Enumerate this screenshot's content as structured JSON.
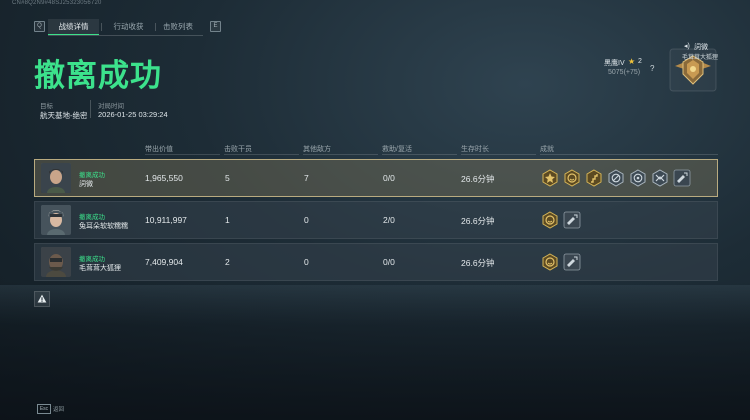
{
  "watermark": "CN#8Q2N9#48SJ25323056720",
  "tabs": {
    "left_key": "Q",
    "right_key": "E",
    "items": [
      {
        "label": "战绩详情",
        "active": true
      },
      {
        "label": "行动收获",
        "active": false
      },
      {
        "label": "击败列表",
        "active": false
      }
    ]
  },
  "result_title": "撤离成功",
  "meta": {
    "target_label": "目标",
    "target_value": "航天基地-绝密",
    "time_label": "对局时间",
    "time_value": "2026-01-25 03:29:24"
  },
  "rank": {
    "audio_label": "詞微",
    "player_tag": "毛茸茸大狐狸",
    "name": "黑鹰IV",
    "level": "2",
    "score": "5075(+75)",
    "help": "?"
  },
  "table": {
    "headers": [
      "带出价值",
      "击败干员",
      "其他敌方",
      "救助/复活",
      "生存时长",
      "成就"
    ],
    "rows": [
      {
        "status": "撤离成功",
        "name": "詞微",
        "value": "1,965,550",
        "kills": "5",
        "other": "7",
        "assist": "0/0",
        "time": "26.6分钟",
        "selected": true,
        "achievements": [
          "gold-star-medal-icon",
          "gold-smile-medal-icon",
          "gold-stairs-medal-icon",
          "silver-no-kill-medal-icon",
          "silver-target-medal-icon",
          "silver-wing-medal-icon",
          "weapon-upgrade-icon"
        ]
      },
      {
        "status": "撤离成功",
        "name": "兔耳朵软软糯糯",
        "value": "10,911,997",
        "kills": "1",
        "other": "0",
        "assist": "2/0",
        "time": "26.6分钟",
        "selected": false,
        "achievements": [
          "gold-smile-medal-icon",
          "weapon-upgrade-icon"
        ]
      },
      {
        "status": "撤离成功",
        "name": "毛茸茸大狐狸",
        "value": "7,409,904",
        "kills": "2",
        "other": "0",
        "assist": "0/0",
        "time": "26.6分钟",
        "selected": false,
        "achievements": [
          "gold-smile-medal-icon",
          "weapon-upgrade-icon"
        ]
      }
    ]
  },
  "footer": {
    "key": "Esc",
    "label": "返回"
  },
  "colors": {
    "accent_green": "#3ce28c",
    "selected_border": "#b9ab80",
    "gold": "#d7b656",
    "silver": "#aab6bf"
  }
}
